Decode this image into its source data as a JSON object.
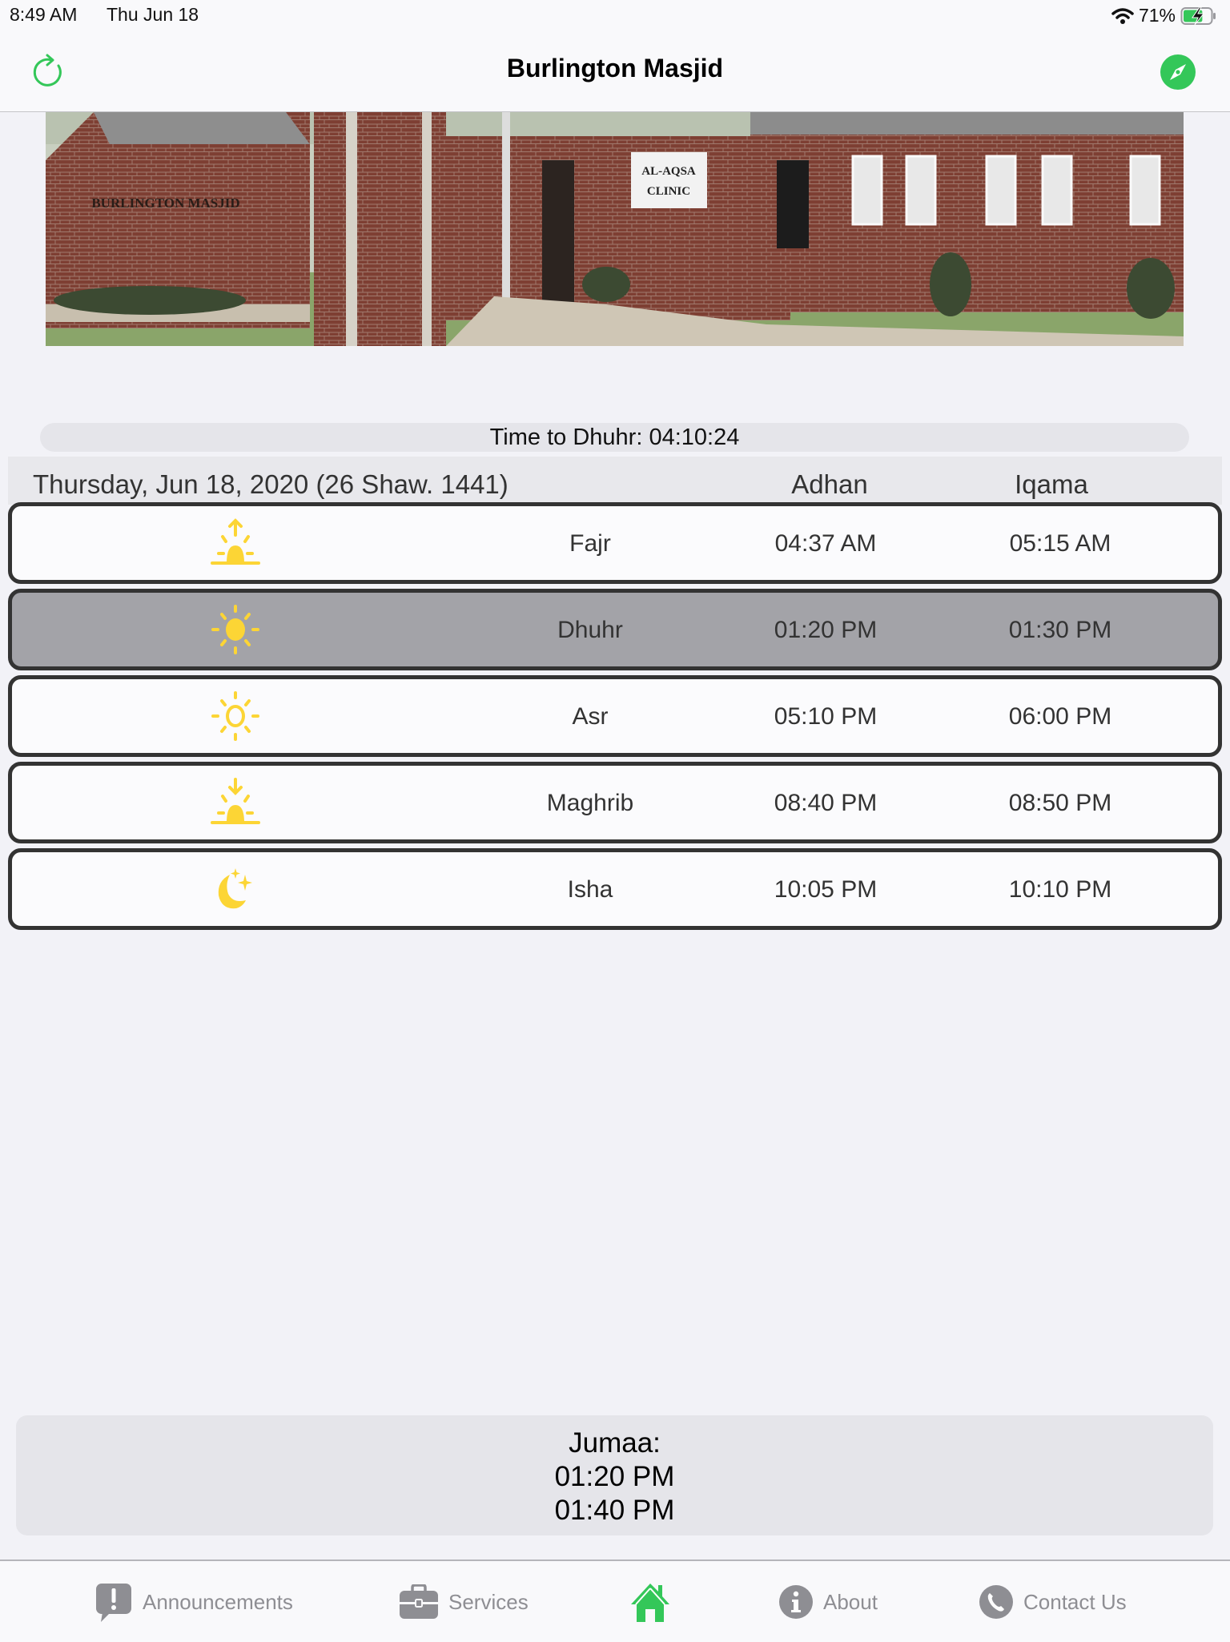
{
  "status_bar": {
    "time": "8:49 AM",
    "date": "Thu Jun 18",
    "battery_percent": "71%",
    "battery_level": 0.71,
    "charging": true,
    "wifi": "wifi-icon"
  },
  "nav": {
    "title": "Burlington Masjid",
    "left_icon": "refresh-icon",
    "right_icon": "compass-icon",
    "accent_color": "#34c759"
  },
  "photo": {
    "description": "Burlington Masjid building exterior",
    "signs": [
      "BURLINGTON MASJID",
      "AL-AQSA",
      "CLINIC"
    ]
  },
  "countdown": {
    "text": "Time to Dhuhr: 04:10:24"
  },
  "table": {
    "date_label": "Thursday, Jun 18, 2020 (26 Shaw. 1441)",
    "col_adhan": "Adhan",
    "col_iqama": "Iqama",
    "rows": [
      {
        "icon": "sunrise-icon",
        "name": "Fajr",
        "adhan": "04:37 AM",
        "iqama": "05:15 AM",
        "active": false
      },
      {
        "icon": "sun-filled-icon",
        "name": "Dhuhr",
        "adhan": "01:20 PM",
        "iqama": "01:30 PM",
        "active": true
      },
      {
        "icon": "sun-outline-icon",
        "name": "Asr",
        "adhan": "05:10 PM",
        "iqama": "06:00 PM",
        "active": false
      },
      {
        "icon": "sunset-icon",
        "name": "Maghrib",
        "adhan": "08:40 PM",
        "iqama": "08:50 PM",
        "active": false
      },
      {
        "icon": "moon-stars-icon",
        "name": "Isha",
        "adhan": "10:05 PM",
        "iqama": "10:10 PM",
        "active": false
      }
    ],
    "icon_color": "#fcd535",
    "active_row_color": "#a3a3a8"
  },
  "jumaa": {
    "label": "Jumaa:",
    "times": [
      "01:20 PM",
      "01:40 PM"
    ]
  },
  "tabbar": {
    "items": [
      {
        "label": "Announcements",
        "icon": "announcement-icon",
        "selected": false
      },
      {
        "label": "Services",
        "icon": "briefcase-icon",
        "selected": false
      },
      {
        "label": "",
        "icon": "home-icon",
        "selected": true
      },
      {
        "label": "About",
        "icon": "info-icon",
        "selected": false
      },
      {
        "label": "Contact Us",
        "icon": "phone-icon",
        "selected": false
      }
    ],
    "selected_color": "#34c759",
    "inactive_color": "#8e8e93"
  }
}
